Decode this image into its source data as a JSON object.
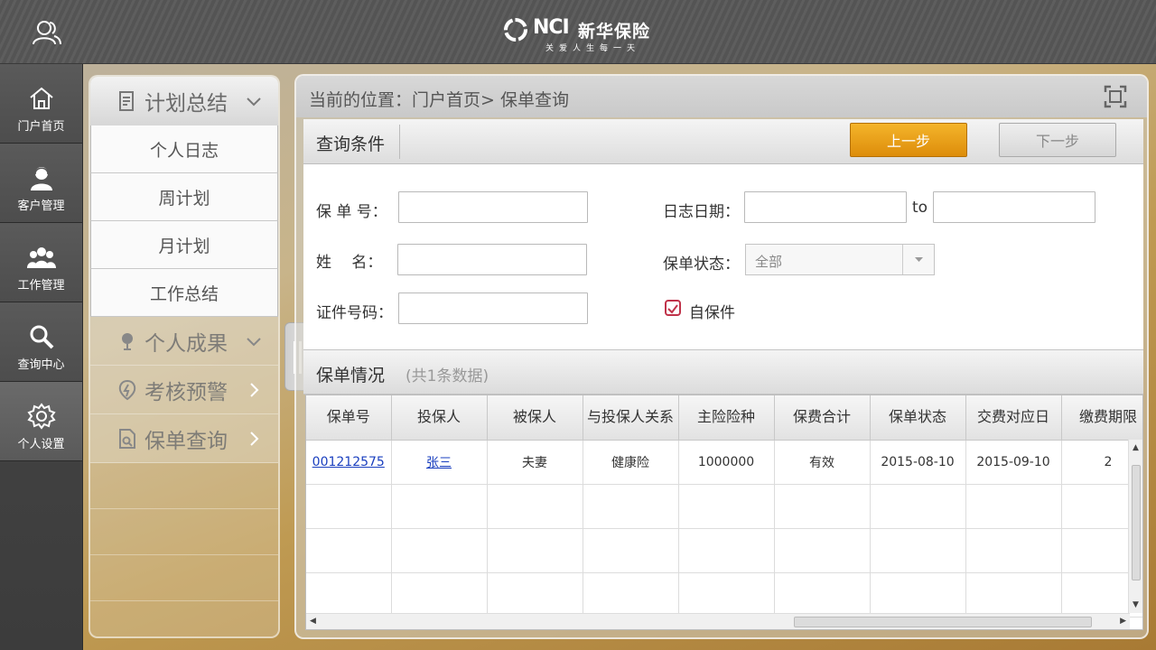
{
  "topbar": {
    "logo_mark": "NCI",
    "logo_name": "新华保险",
    "logo_slogan": "关爱人生每一天"
  },
  "leftnav": {
    "items": [
      {
        "label": "门户首页",
        "icon": "home-icon"
      },
      {
        "label": "客户管理",
        "icon": "customer-icon"
      },
      {
        "label": "工作管理",
        "icon": "team-icon"
      },
      {
        "label": "查询中心",
        "icon": "search-icon"
      },
      {
        "label": "个人设置",
        "icon": "gear-icon",
        "active": true
      }
    ]
  },
  "subnav": {
    "sections": [
      {
        "label": "计划总结",
        "icon": "document-icon",
        "expanded": true,
        "items": [
          "个人日志",
          "周计划",
          "月计划",
          "工作总结"
        ]
      },
      {
        "label": "个人成果",
        "icon": "trophy-icon"
      },
      {
        "label": "考核预警",
        "icon": "warning-icon"
      },
      {
        "label": "保单查询",
        "icon": "doc-search-icon"
      }
    ]
  },
  "breadcrumb": "当前的位置：门户首页> 保单查询",
  "query": {
    "title": "查询条件",
    "prev_label": "上一步",
    "next_label": "下一步",
    "policy_no_label": "保 单 号：",
    "name_label": "姓　 名：",
    "id_no_label": "证件号码：",
    "log_date_label": "日志日期：",
    "to_label": "to",
    "status_label": "保单状态：",
    "status_value": "全部",
    "self_policy_label": "自保件",
    "self_policy_checked": true
  },
  "results": {
    "title": "保单情况",
    "count_text": "(共1条数据)",
    "columns": [
      "保单号",
      "投保人",
      "被保人",
      "与投保人关系",
      "主险险种",
      "保费合计",
      "保单状态",
      "交费对应日",
      "缴费期限"
    ],
    "rows": [
      [
        "001212575",
        "张三",
        "夫妻",
        "健康险",
        "1000000",
        "有效",
        "2015-08-10",
        "2015-09-10",
        "2"
      ]
    ]
  },
  "colors": {
    "accent_orange": "#e69a14",
    "link_blue": "#1a3fbf",
    "checkbox_red": "#c0334a"
  }
}
